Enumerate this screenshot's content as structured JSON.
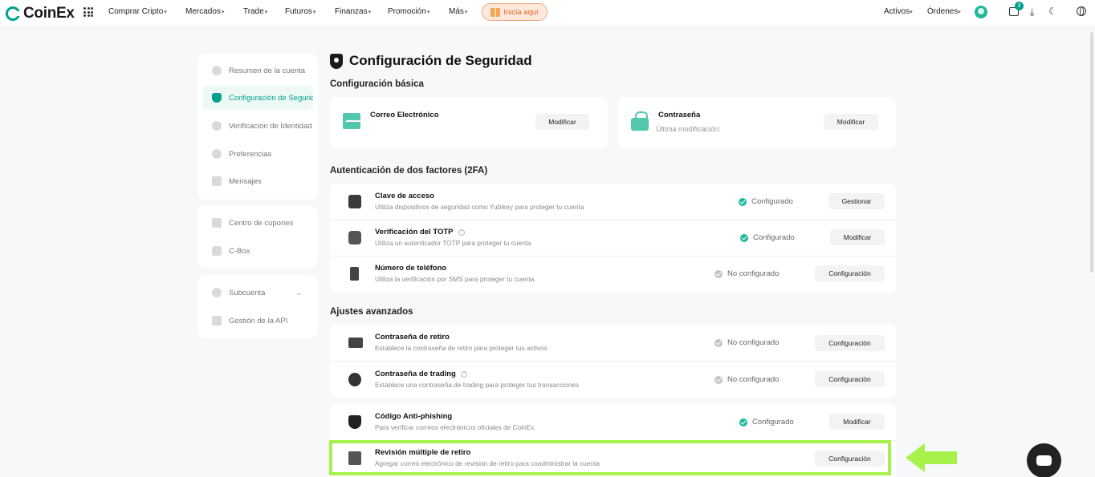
{
  "brand": {
    "name": "CoinEx",
    "accent": "#00a18b"
  },
  "nav": {
    "items": [
      {
        "label": "Comprar Cripto"
      },
      {
        "label": "Mercados"
      },
      {
        "label": "Trade"
      },
      {
        "label": "Futuros"
      },
      {
        "label": "Finanzas"
      },
      {
        "label": "Promoción"
      },
      {
        "label": "Más"
      }
    ],
    "promo_label": "Inicia aquí",
    "right": {
      "assets": "Activos",
      "orders": "Órdenes",
      "notification_count": "3"
    }
  },
  "sidebar": {
    "groups": [
      {
        "items": [
          {
            "label": "Resumen de la cuenta",
            "icon": "pie-chart-icon"
          },
          {
            "label": "Configuración de Seguridad",
            "icon": "shield-icon",
            "active": true
          },
          {
            "label": "Verificación de Identidad",
            "icon": "id-icon"
          },
          {
            "label": "Preferencias",
            "icon": "settings-icon"
          },
          {
            "label": "Mensajes",
            "icon": "message-icon"
          }
        ]
      },
      {
        "items": [
          {
            "label": "Centro de cupones",
            "icon": "coupon-icon"
          },
          {
            "label": "C-Box",
            "icon": "box-icon"
          }
        ]
      },
      {
        "items": [
          {
            "label": "Subcuenta",
            "icon": "subaccount-icon",
            "expandable": true
          },
          {
            "label": "Gestión de la API",
            "icon": "api-icon"
          }
        ]
      }
    ]
  },
  "main": {
    "title": "Configuración de Seguridad",
    "basic": {
      "title": "Configuración básica",
      "email": {
        "label": "Correo Electrónico",
        "button": "Modificar"
      },
      "password": {
        "label": "Contraseña",
        "sub": "Última modificación:",
        "button": "Modificar"
      }
    },
    "twofa": {
      "title": "Autenticación de dos factores (2FA)",
      "rows": [
        {
          "title": "Clave de acceso",
          "desc": "Utiliza dispositivos de seguridad como Yubikey para proteger tu cuenta",
          "status": "Configurado",
          "configured": true,
          "button": "Gestionar"
        },
        {
          "title": "Verificación del TOTP",
          "desc": "Utiliza un autenticador TOTP para proteger tu cuenta",
          "status": "Configurado",
          "configured": true,
          "button": "Modificar"
        },
        {
          "title": "Número de teléfono",
          "desc": "Utiliza la verificación por SMS para proteger tu cuenta.",
          "status": "No configurado",
          "configured": false,
          "button": "Configuración"
        }
      ]
    },
    "advanced": {
      "title": "Ajustes avanzados",
      "rows": [
        {
          "title": "Contraseña de retiro",
          "desc": "Establece la contraseña de retiro para proteger tus activos",
          "status": "No configurado",
          "configured": false,
          "button": "Configuración"
        },
        {
          "title": "Contraseña de trading",
          "desc": "Establece una contraseña de trading para proteger tus transacciones",
          "status": "No configurado",
          "configured": false,
          "button": "Configuración"
        }
      ],
      "rows2": [
        {
          "title": "Código Anti-phishing",
          "desc": "Para verificar correos electrónicos oficiales de CoinEx.",
          "status": "Configurado",
          "configured": true,
          "button": "Modificar"
        },
        {
          "title": "Revisión múltiple de retiro",
          "desc": "Agregar correo electrónico de revisión de retiro para coadministrar la cuenta",
          "status": "",
          "button": "Configuración"
        }
      ]
    }
  },
  "colors": {
    "highlight": "#a6f24a",
    "status_on": "#1fb89c",
    "status_off": "#c4c4c4"
  }
}
